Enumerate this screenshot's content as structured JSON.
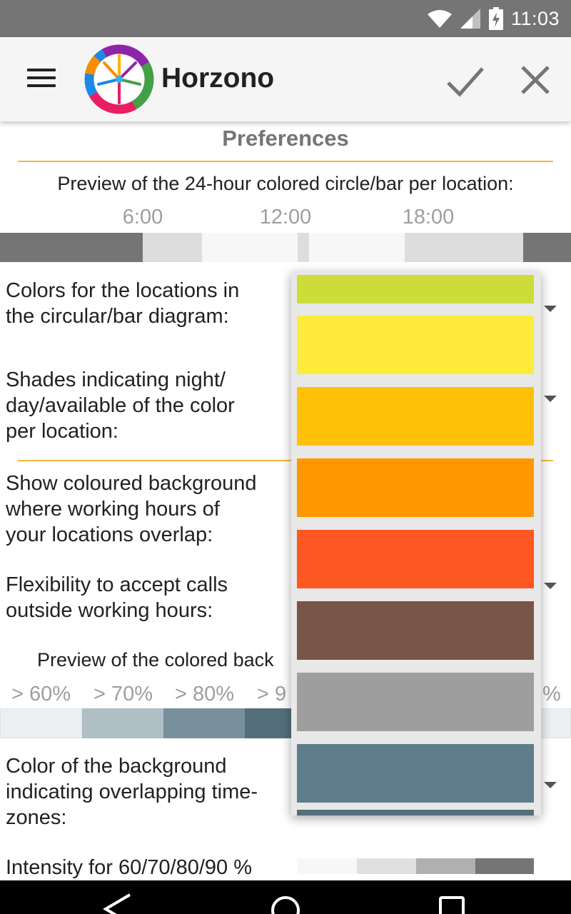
{
  "status_bar": {
    "time": "11:03",
    "icons": [
      "wifi-icon",
      "signal-icon",
      "battery-charging-icon"
    ]
  },
  "app_bar": {
    "title": "Horzono",
    "menu_icon": "menu-icon",
    "confirm_icon": "check-icon",
    "close_icon": "close-icon"
  },
  "preferences": {
    "title": "Preferences",
    "preview_label": "Preview of the 24-hour colored circle/bar per location:",
    "time_ticks": [
      "6:00",
      "12:00",
      "18:00"
    ],
    "colors_label": "Colors for the locations in\nthe circular/bar diagram:",
    "shades_label": "Shades indicating night/\nday/available of the color\nper location:",
    "overlap_bg_label": "Show coloured background\nwhere working hours of\nyour locations overlap:",
    "flexibility_label": "Flexibility to accept calls\noutside working hours:",
    "overlap_preview_label": "Preview of the colored back",
    "overlap_percents": [
      "> 60%",
      "> 70%",
      "> 80%",
      "> 9",
      "%"
    ],
    "bg_color_label": "Color of the background\nindicating overlapping time-\nzones:",
    "intensity_label": "Intensity for 60/70/80/90 %"
  },
  "color_picker": {
    "options": [
      "#cddc39",
      "#ffeb3b",
      "#ffc107",
      "#ff9800",
      "#ff5722",
      "#795548",
      "#9e9e9e",
      "#607d8b",
      "#546e7a"
    ]
  },
  "colors": {
    "accent_divider": "#f5b53d",
    "status_bar": "#757575",
    "app_bar": "#f5f5f5"
  }
}
